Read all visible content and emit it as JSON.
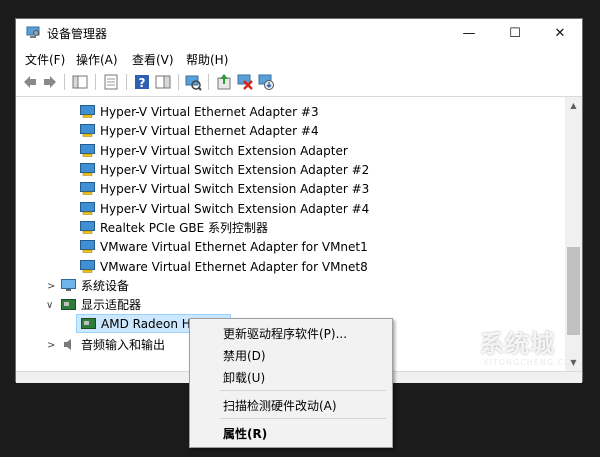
{
  "window": {
    "title": "设备管理器",
    "controls": {
      "minimize": "—",
      "maximize": "☐",
      "close": "✕"
    }
  },
  "menubar": {
    "items": [
      {
        "label": "文件(F)"
      },
      {
        "label": "操作(A)"
      },
      {
        "label": "查看(V)"
      },
      {
        "label": "帮助(H)"
      }
    ]
  },
  "toolbar": {
    "icons": [
      "back-arrow-icon",
      "forward-arrow-icon",
      "console-tree-icon",
      "properties-icon",
      "help-icon",
      "action-pane-icon",
      "scan-hardware-icon",
      "update-driver-icon",
      "uninstall-device-icon",
      "download-icon"
    ]
  },
  "tree": {
    "network_adapters": [
      "Hyper-V Virtual Ethernet Adapter #3",
      "Hyper-V Virtual Ethernet Adapter #4",
      "Hyper-V Virtual Switch Extension Adapter",
      "Hyper-V Virtual Switch Extension Adapter #2",
      "Hyper-V Virtual Switch Extension Adapter #3",
      "Hyper-V Virtual Switch Extension Adapter #4",
      "Realtek PCIe GBE 系列控制器",
      "VMware Virtual Ethernet Adapter for VMnet1",
      "VMware Virtual Ethernet Adapter for VMnet8"
    ],
    "system_devices": "系统设备",
    "display_adapters": "显示适配器",
    "display_child": "AMD Radeon HD",
    "audio": "音频输入和输出"
  },
  "context_menu": {
    "update": "更新驱动程序软件(P)...",
    "disable": "禁用(D)",
    "uninstall": "卸载(U)",
    "scan": "扫描检测硬件改动(A)",
    "properties": "属性(R)"
  },
  "watermark": {
    "text": "系统城",
    "sub": "XITONGCHENG.CC"
  },
  "colors": {
    "window_bg": "#ffffff",
    "chrome": "#f0f0f0",
    "desktop": "#1b1b1b",
    "selection": "#cce8ff"
  }
}
